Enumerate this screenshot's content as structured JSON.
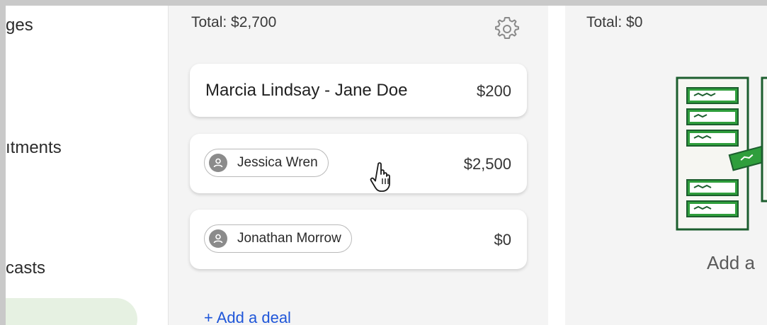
{
  "sidebar": {
    "items": [
      {
        "label": "ges"
      },
      {
        "label": "ıtments"
      },
      {
        "label": "casts"
      }
    ]
  },
  "stage": {
    "total": "Total: $2,700",
    "deals": [
      {
        "title": "Marcia Lindsay - Jane Doe",
        "amount": "$200"
      },
      {
        "contact": "Jessica Wren",
        "amount": "$2,500"
      },
      {
        "contact": "Jonathan Morrow",
        "amount": "$0"
      }
    ],
    "add_deal": "+ Add a deal"
  },
  "stage2": {
    "total": "Total: $0",
    "empty_text": "Add a"
  },
  "colors": {
    "accent_green": "#2f9e3c",
    "dark_green": "#1c5e2e",
    "link_blue": "#1f56d9",
    "active_sidebar_bg": "#e6f1e2"
  },
  "icons": [
    "gear-icon",
    "person-icon",
    "hand-pointer-icon",
    "empty-pipeline-illustration"
  ]
}
